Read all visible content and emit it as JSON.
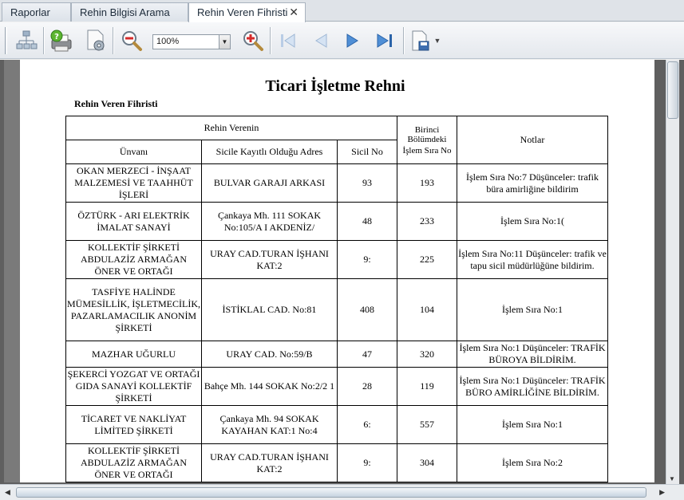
{
  "tabs": [
    {
      "label": "Raporlar"
    },
    {
      "label": "Rehin Bilgisi Arama"
    },
    {
      "label": "Rehin Veren Fihristi"
    }
  ],
  "toolbar": {
    "zoom_value": "100%"
  },
  "document": {
    "title": "Ticari İşletme Rehni",
    "subtitle": "Rehin Veren Fihristi",
    "headers": {
      "rehin_verenin": "Rehin Verenin",
      "birinci_bolumdeki": "Birinci Bölümdeki",
      "notlar": "Notlar",
      "unvani": "Ünvanı",
      "adres": "Sicile Kayıtlı Olduğu Adres",
      "sicil_no": "Sicil No",
      "islem_sira_no": "İşlem Sıra No"
    },
    "rows": [
      {
        "unvan": "OKAN MERZECİ - İNŞAAT MALZEMESİ VE TAAHHÜT İŞLERİ",
        "adres": "BULVAR GARAJI ARKASI",
        "sicil": "93",
        "islem": "193",
        "not": "İşlem Sıra No:7 Düşünceler: trafik büra amirliğine bildirim"
      },
      {
        "unvan": "ÖZTÜRK - ARI ELEKTRİK İMALAT SANAYİ",
        "adres": "Çankaya Mh. 111 SOKAK No:105/A I AKDENİZ/",
        "sicil": "48",
        "islem": "233",
        "not": "İşlem Sıra No:1("
      },
      {
        "unvan": "KOLLEKTİF ŞİRKETİ ABDULAZİZ ARMAĞAN ÖNER VE ORTAĞI",
        "adres": "URAY CAD.TURAN İŞHANI KAT:2",
        "sicil": "9:",
        "islem": "225",
        "not": "İşlem Sıra No:11 Düşünceler: trafik ve tapu sicil müdürlüğüne bildirim."
      },
      {
        "unvan": "TASFİYE HALİNDE MÜMESİLLİK, İŞLETMECİLİK, PAZARLAMACILIK ANONİM ŞİRKETİ",
        "adres": "İSTİKLAL CAD. No:81",
        "sicil": "408",
        "islem": "104",
        "not": "İşlem Sıra No:1"
      },
      {
        "unvan": "MAZHAR UĞURLU",
        "adres": "URAY CAD. No:59/B",
        "sicil": "47",
        "islem": "320",
        "not": "İşlem Sıra No:1 Düşünceler: TRAFİK BÜROYA BİLDİRİM."
      },
      {
        "unvan": "ŞEKERCİ YOZGAT VE ORTAĞI GIDA SANAYİ KOLLEKTİF ŞİRKETİ",
        "adres": "Bahçe Mh. 144 SOKAK No:2/2 1",
        "sicil": "28",
        "islem": "119",
        "not": "İşlem Sıra No:1 Düşünceler: TRAFİK BÜRO AMİRLİĞİNE BİLDİRİM."
      },
      {
        "unvan": "TİCARET VE NAKLİYAT LİMİTED ŞİRKETİ",
        "adres": "Çankaya Mh. 94 SOKAK KAYAHAN KAT:1 No:4",
        "sicil": "6:",
        "islem": "557",
        "not": "İşlem Sıra No:1"
      },
      {
        "unvan": "KOLLEKTİF ŞİRKETİ ABDULAZİZ ARMAĞAN ÖNER VE ORTAĞI",
        "adres": "URAY CAD.TURAN İŞHANI KAT:2",
        "sicil": "9:",
        "islem": "304",
        "not": "İşlem Sıra No:2"
      }
    ]
  }
}
